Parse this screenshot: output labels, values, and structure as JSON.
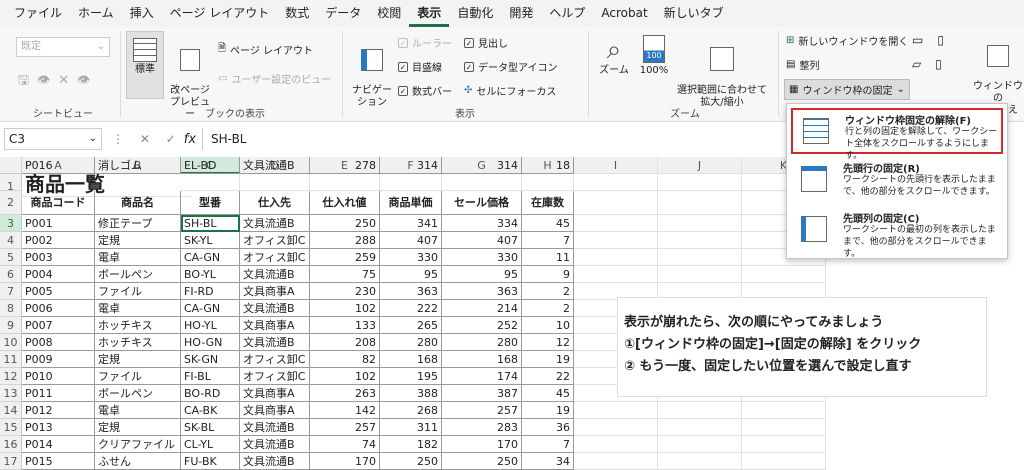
{
  "menu": [
    "ファイル",
    "ホーム",
    "挿入",
    "ページ レイアウト",
    "数式",
    "データ",
    "校閲",
    "表示",
    "自動化",
    "開発",
    "ヘルプ",
    "Acrobat",
    "新しいタブ"
  ],
  "ribbon": {
    "sheet_view": {
      "dropdown": "既定",
      "label": "シートビュー"
    },
    "book_view": {
      "normal": "標準",
      "page_break": "改ページ\nプレビュー",
      "page_layout": "ページ レイアウト",
      "custom": "ユーザー設定のビュー",
      "label": "ブックの表示"
    },
    "show": {
      "nav": "ナビゲー\nション",
      "ruler": "ルーラー",
      "gridlines": "目盛線",
      "formula_bar": "数式バー",
      "headings": "見出し",
      "data_icons": "データ型アイコン",
      "focus": "セルにフォーカス",
      "label": "表示"
    },
    "zoom": {
      "zoom": "ズーム",
      "zoom100": "100%",
      "fit": "選択範囲に合わせて\n拡大/縮小",
      "label": "ズーム",
      "icon100": "100"
    },
    "window": {
      "new_window": "新しいウィンドウを開く",
      "arrange": "整列",
      "freeze": "ウィンドウ枠の固定",
      "switch": "ウィンドウの\n切り替え"
    }
  },
  "formula_bar": {
    "name_box": "C3",
    "fx": "fx",
    "content": "SH-BL"
  },
  "columns": [
    "A",
    "B",
    "C",
    "D",
    "E",
    "F",
    "G",
    "H",
    "I",
    "J",
    "K"
  ],
  "selected_col": "C",
  "title": "商品一覧",
  "headers": [
    "商品コード",
    "商品名",
    "型番",
    "仕入先",
    "仕入れ値",
    "商品単価",
    "セール価格",
    "在庫数"
  ],
  "rows": [
    [
      "P001",
      "修正テープ",
      "SH-BL",
      "文具流通B",
      "250",
      "341",
      "334",
      "45"
    ],
    [
      "P002",
      "定規",
      "SK-YL",
      "オフィス卸C",
      "288",
      "407",
      "407",
      "7"
    ],
    [
      "P003",
      "電卓",
      "CA-GN",
      "オフィス卸C",
      "259",
      "330",
      "330",
      "11"
    ],
    [
      "P004",
      "ボールペン",
      "BO-YL",
      "文具流通B",
      "75",
      "95",
      "95",
      "9"
    ],
    [
      "P005",
      "ファイル",
      "FI-RD",
      "文具商事A",
      "230",
      "363",
      "363",
      "2"
    ],
    [
      "P006",
      "電卓",
      "CA-GN",
      "文具流通B",
      "102",
      "222",
      "214",
      "2"
    ],
    [
      "P007",
      "ホッチキス",
      "HO-YL",
      "文具商事A",
      "133",
      "265",
      "252",
      "10"
    ],
    [
      "P008",
      "ホッチキス",
      "HO-GN",
      "文具流通B",
      "208",
      "280",
      "280",
      "12"
    ],
    [
      "P009",
      "定規",
      "SK-GN",
      "オフィス卸C",
      "82",
      "168",
      "168",
      "19"
    ],
    [
      "P010",
      "ファイル",
      "FI-BL",
      "オフィス卸C",
      "102",
      "195",
      "174",
      "22"
    ],
    [
      "P011",
      "ボールペン",
      "BO-RD",
      "文具商事A",
      "263",
      "388",
      "387",
      "45"
    ],
    [
      "P012",
      "電卓",
      "CA-BK",
      "文具商事A",
      "142",
      "268",
      "257",
      "19"
    ],
    [
      "P013",
      "定規",
      "SK-BL",
      "文具流通B",
      "257",
      "311",
      "283",
      "36"
    ],
    [
      "P014",
      "クリアファイル",
      "CL-YL",
      "文具流通B",
      "74",
      "182",
      "170",
      "7"
    ],
    [
      "P015",
      "ふせん",
      "FU-BK",
      "文具流通B",
      "170",
      "250",
      "250",
      "34"
    ],
    [
      "P016",
      "消しゴム",
      "EL-BD",
      "文具流通B",
      "278",
      "314",
      "314",
      "18"
    ]
  ],
  "row_numbers": [
    "1",
    "2",
    "3",
    "4",
    "5",
    "6",
    "7",
    "8",
    "9",
    "10",
    "11",
    "12",
    "13",
    "14",
    "15",
    "16",
    "17"
  ],
  "dropdown": [
    {
      "title": "ウィンドウ枠固定の解除(F)",
      "desc": "行と列の固定を解除して、ワークシート全体をスクロールするようにします。"
    },
    {
      "title": "先頭行の固定(R)",
      "desc": "ワークシートの先頭行を表示したままで、他の部分をスクロールできます。"
    },
    {
      "title": "先頭列の固定(C)",
      "desc": "ワークシートの最初の列を表示したままで、他の部分をスクロールできます。"
    }
  ],
  "note": [
    "表示が崩れたら、次の順にやってみましょう",
    "①[ウィンドウ枠の固定]→[固定の解除] をクリック",
    "② もう一度、固定したい位置を選んで設定し直す"
  ]
}
